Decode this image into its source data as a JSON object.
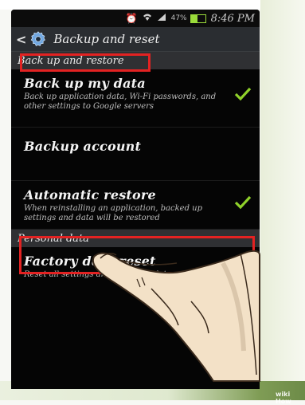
{
  "status_bar": {
    "time": "8:46 PM",
    "battery_percent": "47%",
    "icons": [
      "alarm-icon",
      "wifi-icon",
      "signal-icon",
      "battery-icon"
    ]
  },
  "title_bar": {
    "title": "Backup and reset"
  },
  "sections": {
    "backup": {
      "header": "Back up and restore"
    },
    "personal": {
      "header": "Personal data"
    }
  },
  "items": {
    "backup_my_data": {
      "title": "Back up my data",
      "subtitle": "Back up application data, Wi-Fi passwords, and other settings to Google servers",
      "checked": true
    },
    "backup_account": {
      "title": "Backup account"
    },
    "automatic_restore": {
      "title": "Automatic restore",
      "subtitle": "When reinstalling an application, backed up settings and data will be restored",
      "checked": true
    },
    "factory_reset": {
      "title": "Factory data reset",
      "subtitle": "Reset all settings and delete all data on device"
    }
  },
  "watermark": "wiki How",
  "colors": {
    "highlight_red": "#e32222",
    "checkbox_green": "#8fd12a",
    "background_black": "#050505"
  }
}
